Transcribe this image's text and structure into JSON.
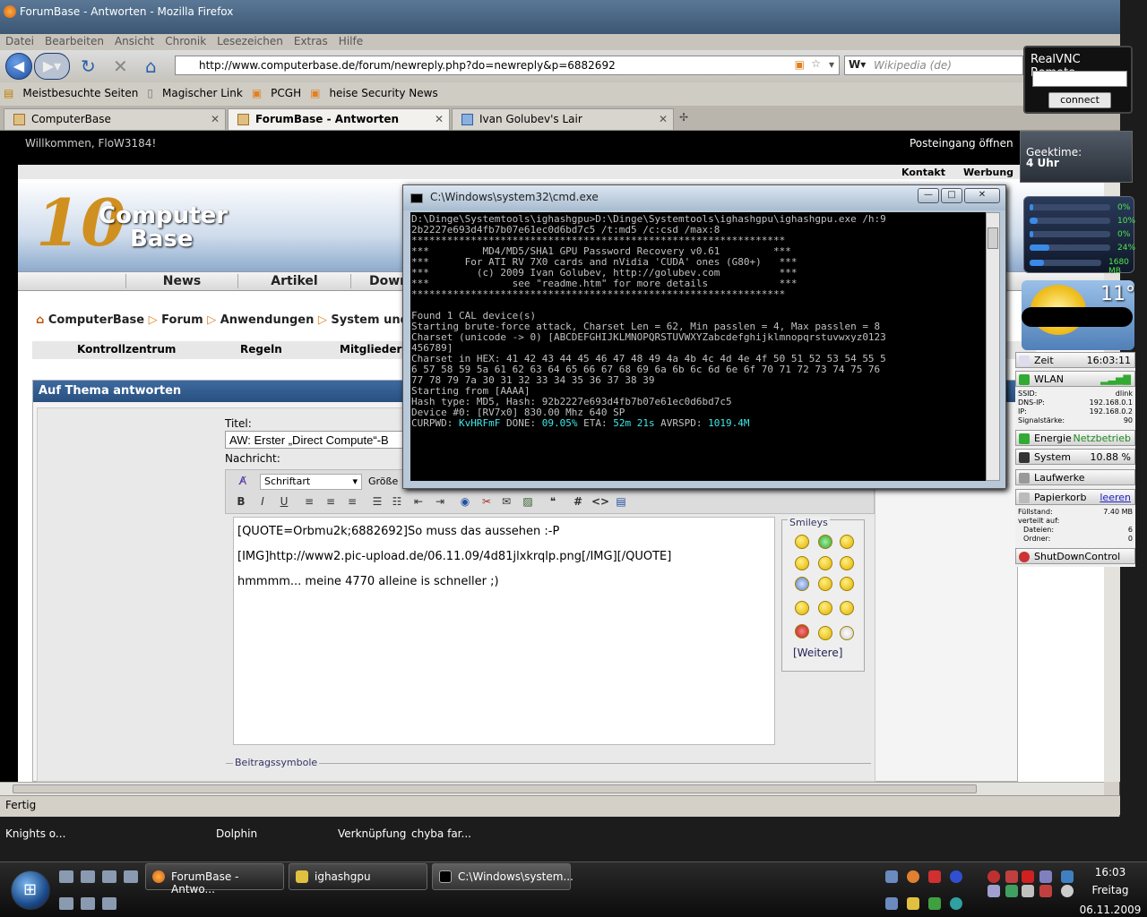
{
  "browser": {
    "title": "ForumBase - Antworten - Mozilla Firefox",
    "menu": [
      "Datei",
      "Bearbeiten",
      "Ansicht",
      "Chronik",
      "Lesezeichen",
      "Extras",
      "Hilfe"
    ],
    "url": "http://www.computerbase.de/forum/newreply.php?do=newreply&p=6882692",
    "search_placeholder": "Wikipedia (de)",
    "bookmarks": [
      "Meistbesuchte Seiten",
      "Magischer Link",
      "PCGH",
      "heise Security News"
    ],
    "tabs": [
      {
        "label": "ComputerBase",
        "active": false
      },
      {
        "label": "ForumBase - Antworten",
        "active": true
      },
      {
        "label": "Ivan Golubev's Lair",
        "active": false
      }
    ],
    "status": "Fertig"
  },
  "forum": {
    "welcome": "Willkommen, FloW3184!",
    "inbox": "Posteingang öffnen",
    "toplinks": [
      "Kontakt",
      "Werbung"
    ],
    "logo_num": "10",
    "logo_line1": "Computer",
    "logo_line2": "Base",
    "nav": [
      "News",
      "Artikel",
      "Down"
    ],
    "breadcrumb": [
      "ComputerBase",
      "Forum",
      "Anwendungen",
      "System und Obe"
    ],
    "subnav": [
      "Kontrollzentrum",
      "Regeln",
      "Mitglieder"
    ],
    "panel_title": "Auf Thema antworten",
    "title_label": "Titel:",
    "title_value": "AW: Erster „Direct Compute“-B",
    "message_label": "Nachricht:",
    "font_select": "Schriftart",
    "size_label": "Größe",
    "message_lines": [
      "[QUOTE=Orbmu2k;6882692]So muss das aussehen :-P",
      "[IMG]http://www2.pic-upload.de/06.11.09/4d81jlxkrqlp.png[/IMG][/QUOTE]",
      "hmmmm... meine 4770 alleine is schneller ;)"
    ],
    "smileys_label": "Smileys",
    "more_smileys": "[Weitere]",
    "post_icons_label": "Beitragssymbole"
  },
  "cmd": {
    "title": "C:\\Windows\\system32\\cmd.exe",
    "lines": [
      "D:\\Dinge\\Systemtools\\ighashgpu>D:\\Dinge\\Systemtools\\ighashgpu\\ighashgpu.exe /h:9",
      "2b2227e693d4fb7b07e61ec0d6bd7c5 /t:md5 /c:csd /max:8",
      "***************************************************************",
      "***         MD4/MD5/SHA1 GPU Password Recovery v0.61         ***",
      "***      For ATI RV 7X0 cards and nVidia 'CUDA' ones (G80+)   ***",
      "***        (c) 2009 Ivan Golubev, http://golubev.com          ***",
      "***              see \"readme.htm\" for more details            ***",
      "***************************************************************",
      "",
      "Found 1 CAL device(s)",
      "Starting brute-force attack, Charset Len = 62, Min passlen = 4, Max passlen = 8",
      "Charset (unicode -> 0) [ABCDEFGHIJKLMNOPQRSTUVWXYZabcdefghijklmnopqrstuvwxyz0123",
      "456789]",
      "Charset in HEX: 41 42 43 44 45 46 47 48 49 4a 4b 4c 4d 4e 4f 50 51 52 53 54 55 5",
      "6 57 58 59 5a 61 62 63 64 65 66 67 68 69 6a 6b 6c 6d 6e 6f 70 71 72 73 74 75 76",
      "77 78 79 7a 30 31 32 33 34 35 36 37 38 39",
      "Starting from [AAAA]",
      "Hash type: MD5, Hash: 92b2227e693d4fb7b07e61ec0d6bd7c5",
      "Device #0: [RV7x0] 830.00 Mhz 640 SP"
    ],
    "status_prefix": "CURPWD: ",
    "curpwd": "KvHRFmF",
    "done_label": " DONE: ",
    "done": "09.05%",
    "eta_label": " ETA: ",
    "eta": "52m 21s",
    "avrspd_label": " AVRSPD: ",
    "avrspd": "1019.4M"
  },
  "vnc": {
    "title": "RealVNC Remote",
    "button": "connect"
  },
  "geektime": {
    "title": "Geektime:",
    "value": "4 Uhr"
  },
  "meters": [
    {
      "label": "0%",
      "fraction": 0.0
    },
    {
      "label": "10%",
      "fraction": 0.1
    },
    {
      "label": "0%",
      "fraction": 0.0
    },
    {
      "label": "24%",
      "fraction": 0.24
    },
    {
      "label": "1680 MB",
      "fraction": 0.2
    }
  ],
  "weather": {
    "temp": "11°"
  },
  "sidebar": {
    "zeit_label": "Zeit",
    "zeit": "16:03:11",
    "wlan_label": "WLAN",
    "ssid_label": "SSID:",
    "ssid": "dlink",
    "dns_label": "DNS-IP:",
    "dns": "192.168.0.1",
    "ip_label": "IP:",
    "ip": "192.168.0.2",
    "signal_label": "Signalstärke:",
    "signal": "90",
    "energie_label": "Energie",
    "energie": "Netzbetrieb",
    "system_label": "System",
    "system": "10.88 %",
    "laufwerke_label": "Laufwerke",
    "papierkorb_label": "Papierkorb",
    "papierkorb_action": "leeren",
    "fuell_label": "Füllstand:",
    "fuell": "7.40 MB",
    "verteilt_label": "verteilt auf:",
    "dateien_label": "Dateien:",
    "dateien": "6",
    "ordner_label": "Ordner:",
    "ordner": "0",
    "shutdown_label": "ShutDownControl"
  },
  "desktop_labels": [
    "Knights o...",
    "Dolphin",
    "Verknüpfung",
    "chyba far..."
  ],
  "taskbar": {
    "buttons": [
      "ForumBase - Antwo...",
      "ighashgpu",
      "C:\\Windows\\system..."
    ],
    "time": "16:03",
    "day": "Freitag",
    "date": "06.11.2009"
  },
  "colors": {
    "accent": "#2a5080",
    "console_cyan": "#40e8e8"
  }
}
